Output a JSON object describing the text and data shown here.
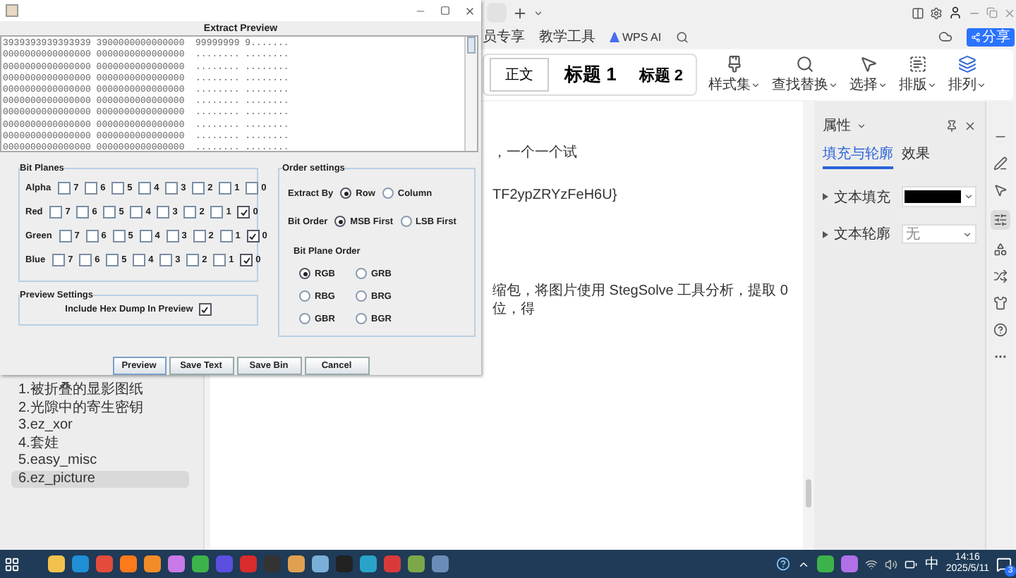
{
  "wps": {
    "menu": [
      "员专享",
      "教学工具"
    ],
    "ai_label": "WPS AI",
    "share": "分享",
    "styles": [
      {
        "label": "正文",
        "kind": "body",
        "selected": true
      },
      {
        "label": "标题 1",
        "kind": "h1",
        "selected": false
      },
      {
        "label": "标题 2",
        "kind": "h2",
        "selected": false
      }
    ],
    "tools": [
      "样式集",
      "查找替换",
      "选择",
      "排版",
      "排列"
    ],
    "nav": [
      {
        "label": "1.被折叠的显影图纸",
        "selected": false
      },
      {
        "label": "2.光隙中的寄生密钥",
        "selected": false
      },
      {
        "label": "3.ez_xor",
        "selected": false
      },
      {
        "label": "4.套娃",
        "selected": false
      },
      {
        "label": "5.easy_misc",
        "selected": false
      },
      {
        "label": "6.ez_picture",
        "selected": true
      }
    ],
    "doc_lines": [
      "，一个一个试",
      "TF2ypZRYzFeH6U}",
      "缩包，将图片使用 StegSolve 工具分析，提取 0 位，得"
    ],
    "properties": {
      "title": "属性",
      "tabs": [
        {
          "label": "填充与轮廓",
          "selected": true
        },
        {
          "label": "效果",
          "selected": false
        }
      ],
      "rows": [
        {
          "label": "文本填充",
          "kind": "swatch"
        },
        {
          "label": "文本轮廓",
          "kind": "select",
          "value": "无"
        }
      ]
    }
  },
  "dialog": {
    "title": "Extract Preview",
    "hex_rows": [
      "3939393939393939 3900000000000000  99999999 9.......",
      "0000000000000000 0000000000000000  ........ ........",
      "0000000000000000 0000000000000000  ........ ........",
      "0000000000000000 0000000000000000  ........ ........",
      "0000000000000000 0000000000000000  ........ ........",
      "0000000000000000 0000000000000000  ........ ........",
      "0000000000000000 0000000000000000  ........ ........",
      "0000000000000000 0000000000000000  ........ ........",
      "0000000000000000 0000000000000000  ........ ........",
      "0000000000000000 0000000000000000  ........ ........"
    ],
    "bit_planes": {
      "title": "Bit Planes",
      "rows": [
        {
          "label": "Alpha",
          "bits": [
            {
              "label": "7",
              "checked": false
            },
            {
              "label": "6",
              "checked": false
            },
            {
              "label": "5",
              "checked": false
            },
            {
              "label": "4",
              "checked": false
            },
            {
              "label": "3",
              "checked": false
            },
            {
              "label": "2",
              "checked": false
            },
            {
              "label": "1",
              "checked": false
            },
            {
              "label": "0",
              "checked": false
            }
          ]
        },
        {
          "label": "Red",
          "bits": [
            {
              "label": "7",
              "checked": false
            },
            {
              "label": "6",
              "checked": false
            },
            {
              "label": "5",
              "checked": false
            },
            {
              "label": "4",
              "checked": false
            },
            {
              "label": "3",
              "checked": false
            },
            {
              "label": "2",
              "checked": false
            },
            {
              "label": "1",
              "checked": false
            },
            {
              "label": "0",
              "checked": true
            }
          ]
        },
        {
          "label": "Green",
          "bits": [
            {
              "label": "7",
              "checked": false
            },
            {
              "label": "6",
              "checked": false
            },
            {
              "label": "5",
              "checked": false
            },
            {
              "label": "4",
              "checked": false
            },
            {
              "label": "3",
              "checked": false
            },
            {
              "label": "2",
              "checked": false
            },
            {
              "label": "1",
              "checked": false
            },
            {
              "label": "0",
              "checked": true
            }
          ]
        },
        {
          "label": "Blue",
          "bits": [
            {
              "label": "7",
              "checked": false
            },
            {
              "label": "6",
              "checked": false
            },
            {
              "label": "5",
              "checked": false
            },
            {
              "label": "4",
              "checked": false
            },
            {
              "label": "3",
              "checked": false
            },
            {
              "label": "2",
              "checked": false
            },
            {
              "label": "1",
              "checked": false
            },
            {
              "label": "0",
              "checked": true
            }
          ]
        }
      ]
    },
    "preview_settings": {
      "title": "Preview Settings",
      "option": {
        "label": "Include Hex Dump In Preview",
        "checked": true
      }
    },
    "order_settings": {
      "title": "Order settings",
      "extract_by": {
        "label": "Extract By",
        "options": [
          {
            "label": "Row",
            "selected": true
          },
          {
            "label": "Column",
            "selected": false
          }
        ]
      },
      "bit_order": {
        "label": "Bit Order",
        "options": [
          {
            "label": "MSB First",
            "selected": true
          },
          {
            "label": "LSB First",
            "selected": false
          }
        ]
      },
      "plane_order": {
        "label": "Bit Plane Order",
        "options": [
          {
            "label": "RGB",
            "selected": true
          },
          {
            "label": "GRB",
            "selected": false
          },
          {
            "label": "RBG",
            "selected": false
          },
          {
            "label": "BRG",
            "selected": false
          },
          {
            "label": "GBR",
            "selected": false
          },
          {
            "label": "BGR",
            "selected": false
          }
        ]
      }
    },
    "buttons": [
      "Preview",
      "Save Text",
      "Save Bin",
      "Cancel"
    ]
  },
  "taskbar": {
    "ime": "中",
    "time": "14:16",
    "date": "2025/5/11",
    "notifications": "3"
  }
}
